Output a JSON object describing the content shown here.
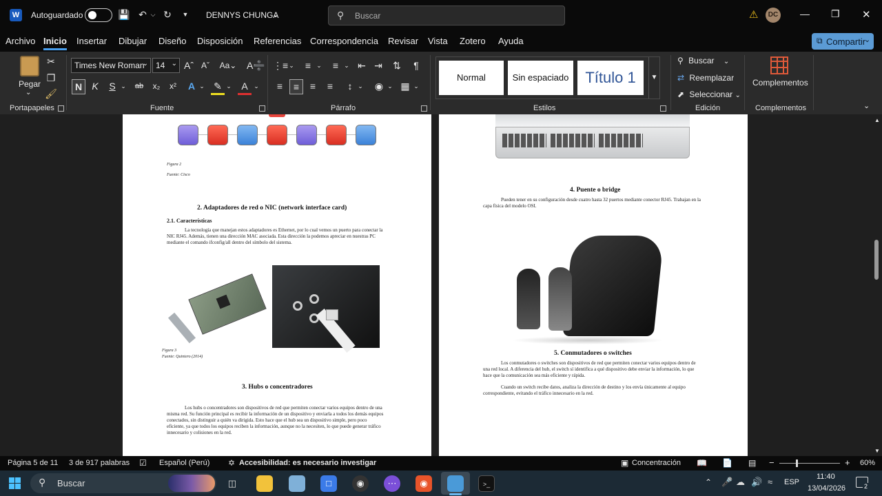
{
  "titlebar": {
    "autosave_label": "Autoguardado",
    "user_name": "DENNYS CHUNGA",
    "search_placeholder": "Buscar",
    "avatar_initials": "DC"
  },
  "menu": {
    "items": [
      "Archivo",
      "Inicio",
      "Insertar",
      "Dibujar",
      "Diseño",
      "Disposición",
      "Referencias",
      "Correspondencia",
      "Revisar",
      "Vista",
      "Zotero",
      "Ayuda"
    ],
    "active": "Inicio",
    "share_label": "Compartir"
  },
  "ribbon": {
    "clipboard": {
      "paste_label": "Pegar",
      "group_label": "Portapapeles"
    },
    "font": {
      "font_name": "Times New Roman",
      "font_size": "14",
      "bold_glyph": "N",
      "italic_glyph": "K",
      "underline_glyph": "S",
      "group_label": "Fuente"
    },
    "paragraph": {
      "group_label": "Párrafo"
    },
    "styles": {
      "tiles": [
        "Normal",
        "Sin espaciado",
        "Título 1"
      ],
      "group_label": "Estilos"
    },
    "editing": {
      "find_label": "Buscar",
      "replace_label": "Reemplazar",
      "select_label": "Seleccionar",
      "group_label": "Edición"
    },
    "addins": {
      "button_label": "Complementos",
      "group_label": "Complementos"
    }
  },
  "document": {
    "left_page": {
      "fig2_caption": "Figura 2",
      "fig2_source": "Fuente: Cisco",
      "section2_heading": "2.  Adaptadores de red o NIC (network interface card)",
      "subsection_heading": "2.1. Características",
      "para1": "La tecnología que manejan estos adaptadores es Ethernet, por lo cual vemos un puerto para conectar la NIC RJ45. Además, tienen una dirección MAC asociada. Esta dirección la podemos apreciar en nuestras PC mediante el comando ifconfig/all dentro del símbolo del sistema.",
      "fig3_caption": "Figura 3",
      "fig3_source": "Fuente: Quintero (2014)",
      "section3_heading": "3.  Hubs o concentradores",
      "para2": "Los hubs o concentradores son dispositivos de red que permiten conectar varios equipos dentro de una misma red. Su función principal es recibir la información de un dispositivo y enviarla a todos los demás equipos conectados, sin distinguir a quién va dirigida. Esto hace que el hub sea un dispositivo simple, pero poco eficiente, ya que todos los equipos reciben la información, aunque no la necesiten, lo que puede generar tráfico innecesario y colisiones en la red."
    },
    "right_page": {
      "section4_heading": "4.  Puente o bridge",
      "para3": "Pueden tener en su configuración desde cuatro hasta 32 puertos mediante conector RJ45. Trabajan en la capa física del modelo OSI.",
      "section5_heading": "5.  Conmutadores o switches",
      "para4": "Los conmutadores o switches son dispositivos de red que permiten conectar varios equipos dentro de una red local. A diferencia del hub, el switch sí identifica a qué dispositivo debe enviar la información, lo que hace que la comunicación sea más eficiente y rápida.",
      "para5": "Cuando un switch recibe datos, analiza la dirección de destino y los envía únicamente al equipo correspondiente, evitando el tráfico innecesario en la red."
    }
  },
  "statusbar": {
    "page_info": "Página 5 de 11",
    "word_count": "3 de 917 palabras",
    "language": "Español (Perú)",
    "accessibility": "Accesibilidad: es necesario investigar",
    "focus_label": "Concentración",
    "zoom": "60%"
  },
  "taskbar": {
    "search_label": "Buscar",
    "language": "ESP",
    "time": "11:40",
    "date": "13/04/2026",
    "notification_count": "2"
  },
  "colors": {
    "accent": "#4aa0f0",
    "share": "#5b9bd5",
    "flow_purple": "#8f7ee8",
    "flow_red": "#e8453c",
    "flow_blue": "#5a9fe6"
  }
}
